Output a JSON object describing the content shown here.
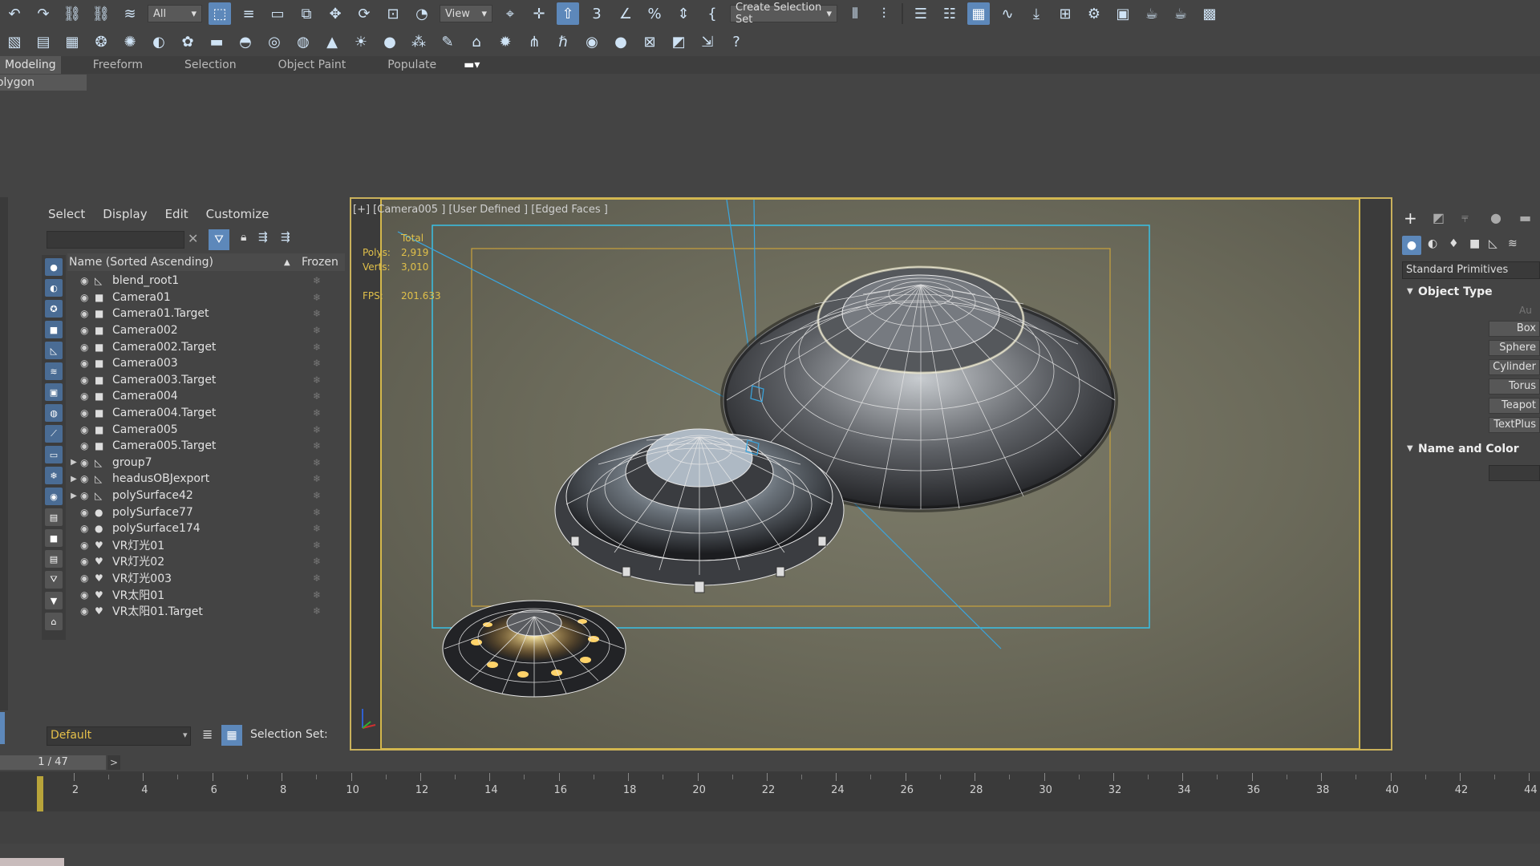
{
  "toolbar1": {
    "selection_filter": "All",
    "ref_coord": "View",
    "create_selection_set": "Create Selection Set"
  },
  "ribbon": {
    "tabs": [
      "Modeling",
      "Freeform",
      "Selection",
      "Object Paint",
      "Populate"
    ],
    "active_tab": "Modeling",
    "sub_tab": "Polygon Modeling"
  },
  "scene_explorer": {
    "menu": [
      "Select",
      "Display",
      "Edit",
      "Customize"
    ],
    "column_name": "Name (Sorted Ascending)",
    "column_frozen": "Frozen",
    "rows": [
      {
        "name": "blend_root1",
        "icon": "bone-icon",
        "expand": false
      },
      {
        "name": "Camera01",
        "icon": "camera-icon",
        "expand": false
      },
      {
        "name": "Camera01.Target",
        "icon": "camera-icon",
        "expand": false
      },
      {
        "name": "Camera002",
        "icon": "camera-icon",
        "expand": false
      },
      {
        "name": "Camera002.Target",
        "icon": "camera-icon",
        "expand": false
      },
      {
        "name": "Camera003",
        "icon": "camera-icon",
        "expand": false
      },
      {
        "name": "Camera003.Target",
        "icon": "camera-icon",
        "expand": false
      },
      {
        "name": "Camera004",
        "icon": "camera-icon",
        "expand": false
      },
      {
        "name": "Camera004.Target",
        "icon": "camera-icon",
        "expand": false
      },
      {
        "name": "Camera005",
        "icon": "camera-icon",
        "expand": false
      },
      {
        "name": "Camera005.Target",
        "icon": "camera-icon",
        "expand": false
      },
      {
        "name": "group7",
        "icon": "bone-icon",
        "expand": true
      },
      {
        "name": "headusOBJexport",
        "icon": "bone-icon",
        "expand": true
      },
      {
        "name": "polySurface42",
        "icon": "bone-icon",
        "expand": true
      },
      {
        "name": "polySurface77",
        "icon": "sphere-icon",
        "expand": false
      },
      {
        "name": "polySurface174",
        "icon": "sphere-icon",
        "expand": false
      },
      {
        "name": "VR灯光01",
        "icon": "light-icon",
        "expand": false
      },
      {
        "name": "VR灯光02",
        "icon": "light-icon",
        "expand": false
      },
      {
        "name": "VR灯光003",
        "icon": "light-icon",
        "expand": false
      },
      {
        "name": "VR太阳01",
        "icon": "light-icon",
        "expand": false
      },
      {
        "name": "VR太阳01.Target",
        "icon": "light-icon",
        "expand": false
      }
    ],
    "layer": "Default",
    "selection_set_label": "Selection Set:"
  },
  "viewport": {
    "label": "[+] [Camera005 ] [User Defined ] [Edged Faces ]",
    "stats_total": "Total",
    "polys_label": "Polys:",
    "polys_value": "2,919",
    "verts_label": "Verts:",
    "verts_value": "3,010",
    "fps_label": "FPS:",
    "fps_value": "201.633"
  },
  "command_panel": {
    "category": "Standard Primitives",
    "object_type": "Object Type",
    "autogrid": "Au",
    "buttons": [
      "Box",
      "Sphere",
      "Cylinder",
      "Torus",
      "Teapot",
      "TextPlus"
    ],
    "name_and_color": "Name and Color"
  },
  "timeline": {
    "frame_counter": "1 / 47",
    "next_label": ">",
    "ticks": [
      "2",
      "4",
      "6",
      "8",
      "10",
      "12",
      "14",
      "16",
      "18",
      "20",
      "22",
      "24",
      "26",
      "28",
      "30",
      "32",
      "34",
      "36",
      "38",
      "40",
      "42",
      "44"
    ]
  },
  "colors": {
    "accent": "#5d88ba",
    "viewport_border": "#d4b84c",
    "safe_frame": "#39c1e6",
    "wire": "#e8e8e8",
    "layer_text": "#e6c04a"
  }
}
